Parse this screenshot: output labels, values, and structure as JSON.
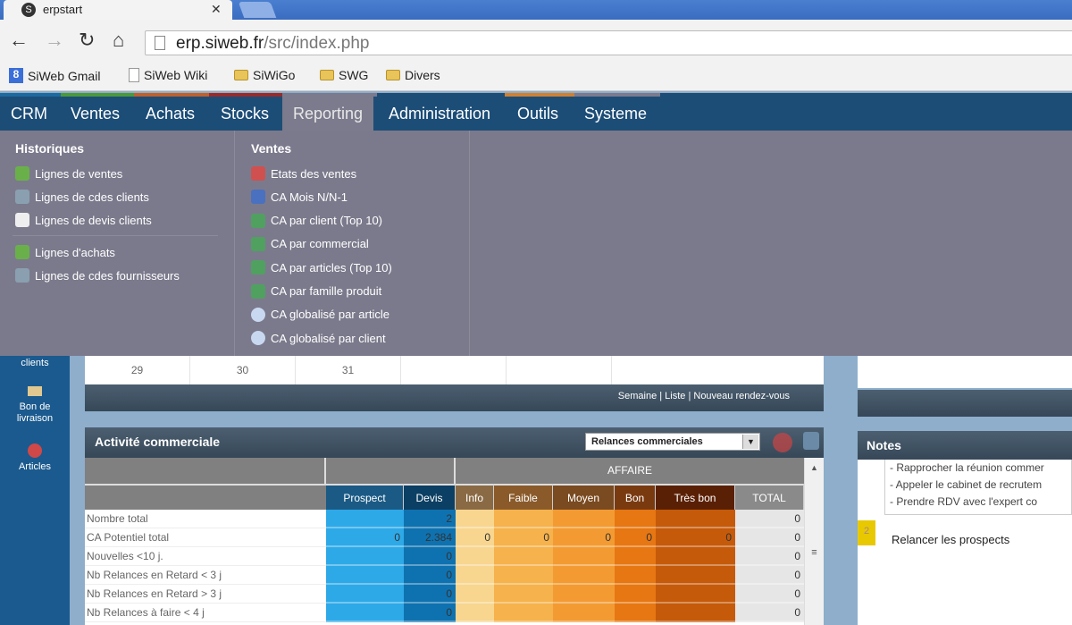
{
  "browser": {
    "tab_title": "erpstart",
    "url_host": "erp.siweb.fr",
    "url_path": "/src/index.php",
    "bookmarks": [
      {
        "label": "SiWeb Gmail",
        "icon": "google-icon"
      },
      {
        "label": "SiWeb Wiki",
        "icon": "page-icon"
      },
      {
        "label": "SiWiGo",
        "icon": "folder-icon"
      },
      {
        "label": "SWG",
        "icon": "folder-icon"
      },
      {
        "label": "Divers",
        "icon": "folder-icon"
      }
    ]
  },
  "nav": {
    "items": [
      "CRM",
      "Ventes",
      "Achats",
      "Stocks",
      "Reporting",
      "Administration",
      "Outils",
      "Systeme"
    ],
    "active": "Reporting"
  },
  "dropdown": {
    "historiques": {
      "title": "Historiques",
      "items": [
        "Lignes de ventes",
        "Lignes de cdes clients",
        "Lignes de devis clients",
        "Lignes d'achats",
        "Lignes de cdes fournisseurs"
      ]
    },
    "ventes": {
      "title": "Ventes",
      "items": [
        "Etats des ventes",
        "CA Mois N/N-1",
        "CA par client (Top 10)",
        "CA par commercial",
        "CA par articles (Top 10)",
        "CA par famille produit",
        "CA globalisé par article",
        "CA globalisé par client"
      ]
    }
  },
  "sidebar": {
    "items": [
      "clients",
      "Bon de livraison",
      "Articles"
    ]
  },
  "calendar": {
    "days": [
      "29",
      "30",
      "31",
      "",
      ""
    ],
    "footer": "Semaine | Liste | Nouveau rendez-vous"
  },
  "activity": {
    "title": "Activité commerciale",
    "select_value": "Relances commerciales",
    "group_header": "AFFAIRE",
    "columns": [
      "Prospect",
      "Devis",
      "Info",
      "Faible",
      "Moyen",
      "Bon",
      "Très bon",
      "TOTAL"
    ],
    "column_colors": [
      "#2ea9e8",
      "#0f72b0",
      "#f8d690",
      "#f6b24c",
      "#f39b32",
      "#e77712",
      "#c55a0a",
      "#e6e6e6"
    ],
    "rows": [
      {
        "label": "Nombre total",
        "values": [
          "",
          "2",
          "",
          "",
          "",
          "",
          "",
          "0"
        ]
      },
      {
        "label": "CA Potentiel total",
        "values": [
          "0",
          "2.384",
          "0",
          "0",
          "0",
          "0",
          "0",
          "0"
        ]
      },
      {
        "label": "Nouvelles <10 j.",
        "values": [
          "",
          "0",
          "",
          "",
          "",
          "",
          "",
          "0"
        ]
      },
      {
        "label": "Nb Relances en Retard < 3 j",
        "values": [
          "",
          "0",
          "",
          "",
          "",
          "",
          "",
          "0"
        ]
      },
      {
        "label": "Nb Relances en Retard > 3 j",
        "values": [
          "",
          "0",
          "",
          "",
          "",
          "",
          "",
          "0"
        ]
      },
      {
        "label": "Nb Relances à faire < 4 j",
        "values": [
          "",
          "0",
          "",
          "",
          "",
          "",
          "",
          "0"
        ]
      }
    ]
  },
  "notes": {
    "title": "Notes",
    "lines": [
      "- Rapprocher la réunion commer",
      "- Appeler le cabinet de recrutem",
      "- Prendre RDV avec l'expert co"
    ],
    "badge": "2",
    "item": "Relancer les prospects"
  }
}
